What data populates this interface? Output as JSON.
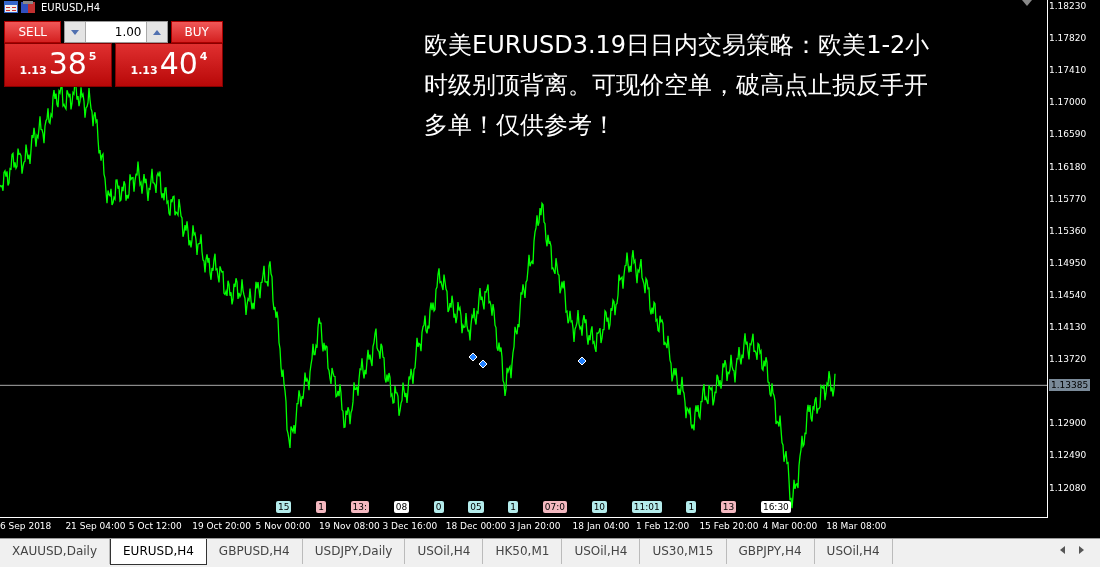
{
  "chart_title": "EURUSD,H4",
  "trade_panel": {
    "sell_label": "SELL",
    "buy_label": "BUY",
    "volume": "1.00",
    "sell_price": {
      "prefix": "1.13",
      "pips": "38",
      "fraction": "5"
    },
    "buy_price": {
      "prefix": "1.13",
      "pips": "40",
      "fraction": "4"
    }
  },
  "overlay_text": "欧美EURUSD3.19日日内交易策略：欧美1-2小时级别顶背离。可现价空单，破高点止损反手开多单！仅供参考！",
  "price_axis": {
    "ticks": [
      "1.18230",
      "1.17820",
      "1.17410",
      "1.17000",
      "1.16590",
      "1.16180",
      "1.15770",
      "1.15360",
      "1.14950",
      "1.14540",
      "1.14130",
      "1.13720",
      "1.12900",
      "1.12490",
      "1.12080"
    ],
    "current_price": "1.13385"
  },
  "time_axis": {
    "ticks": [
      "6 Sep 2018",
      "21 Sep 04:00",
      "5 Oct 12:00",
      "19 Oct 20:00",
      "5 Nov 00:00",
      "19 Nov 08:00",
      "3 Dec 16:00",
      "18 Dec 00:00",
      "3 Jan 20:00",
      "18 Jan 04:00",
      "1 Feb 12:00",
      "15 Feb 20:00",
      "4 Mar 00:00",
      "18 Mar 08:00"
    ]
  },
  "events": [
    {
      "label": "15",
      "color": "#b4ecec"
    },
    {
      "label": "1",
      "color": "#f4b8c0"
    },
    {
      "label": "13:",
      "color": "#f4b8c0"
    },
    {
      "label": "08",
      "color": "#ffffff"
    },
    {
      "label": "0",
      "color": "#b4ecec"
    },
    {
      "label": "05",
      "color": "#b4ecec"
    },
    {
      "label": "1",
      "color": "#b4ecec"
    },
    {
      "label": "07:0",
      "color": "#f4b8c0"
    },
    {
      "label": "10",
      "color": "#b4ecec"
    },
    {
      "label": "11:01",
      "color": "#b4ecec"
    },
    {
      "label": "1",
      "color": "#b4ecec"
    },
    {
      "label": "13",
      "color": "#f4b8c0"
    },
    {
      "label": "16:30",
      "color": "#ffffff"
    }
  ],
  "tabs": [
    {
      "label": "XAUUSD,Daily",
      "selected": false
    },
    {
      "label": "EURUSD,H4",
      "selected": true
    },
    {
      "label": "GBPUSD,H4",
      "selected": false
    },
    {
      "label": "USDJPY,Daily",
      "selected": false
    },
    {
      "label": "USOil,H4",
      "selected": false
    },
    {
      "label": "HK50,M1",
      "selected": false
    },
    {
      "label": "USOil,H4",
      "selected": false
    },
    {
      "label": "US30,M15",
      "selected": false
    },
    {
      "label": "GBPJPY,H4",
      "selected": false
    },
    {
      "label": "USOil,H4",
      "selected": false
    }
  ]
}
